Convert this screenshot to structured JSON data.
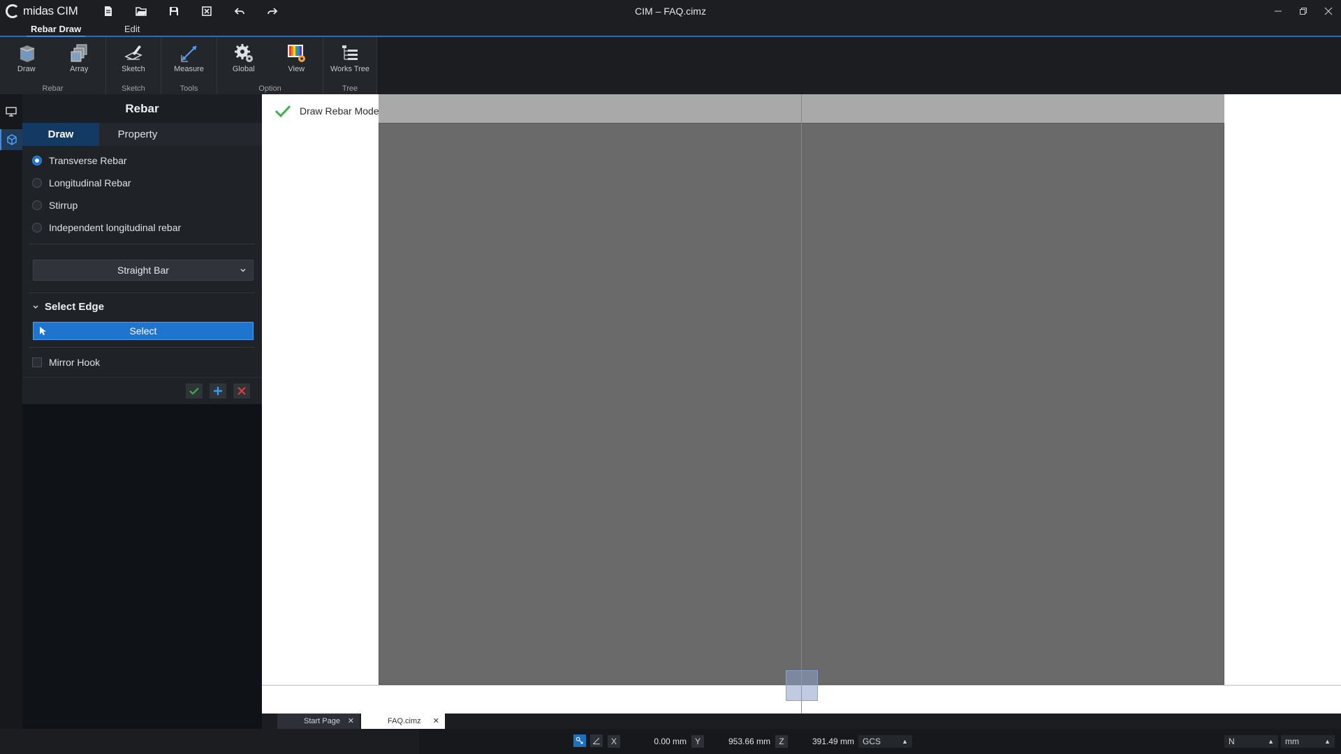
{
  "app": {
    "logo_text": "midas CIM",
    "title": "CIM – FAQ.cimz"
  },
  "ribbon": {
    "tabs": [
      "Rebar Draw",
      "Edit"
    ],
    "groups": [
      {
        "label": "Rebar",
        "buttons": [
          "Draw",
          "Array"
        ]
      },
      {
        "label": "Sketch",
        "buttons": [
          "Sketch"
        ]
      },
      {
        "label": "Tools",
        "buttons": [
          "Measure"
        ]
      },
      {
        "label": "Option",
        "buttons": [
          "Global",
          "View"
        ]
      },
      {
        "label": "Tree",
        "buttons": [
          "Works Tree"
        ]
      }
    ]
  },
  "panel": {
    "title": "Rebar",
    "tabs": [
      "Draw",
      "Property"
    ],
    "rebar_types": [
      "Transverse Rebar",
      "Longitudinal Rebar",
      "Stirrup",
      "Independent longitudinal rebar"
    ],
    "selected_type": "Transverse Rebar",
    "shape_select": "Straight Bar",
    "section_title": "Select Edge",
    "select_button": "Select",
    "mirror_hook_label": "Mirror Hook",
    "mirror_hook_checked": false
  },
  "viewport": {
    "mode_text": "Draw Rebar Mode"
  },
  "doc_tabs": [
    {
      "label": "Start Page",
      "active": false
    },
    {
      "label": "FAQ.cimz",
      "active": true
    }
  ],
  "status": {
    "x_label": "X",
    "x_value": "0.00 mm",
    "y_label": "Y",
    "y_value": "953.66 mm",
    "z_label": "Z",
    "z_value": "391.49 mm",
    "coord_system": "GCS",
    "force_unit": "N",
    "length_unit": "mm"
  },
  "colors": {
    "accent": "#1f74d0",
    "slab": "#6a6a6a",
    "check_green": "#3cb043",
    "delete_red": "#e03a3a"
  }
}
